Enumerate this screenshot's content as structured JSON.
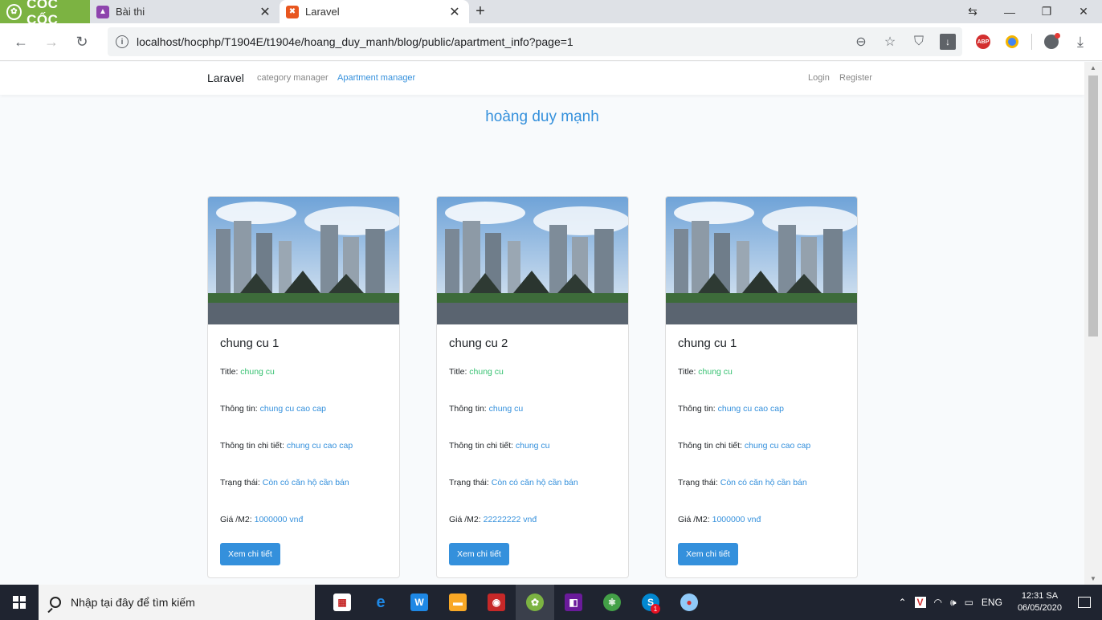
{
  "browser": {
    "brand": "CỐC CỐC",
    "tabs": [
      {
        "title": "Bài thi",
        "favicon_color": "#8e44ad"
      },
      {
        "title": "Laravel",
        "favicon_color": "#e8561f"
      }
    ],
    "url": "localhost/hocphp/T1904E/t1904e/hoang_duy_manh/blog/public/apartment_info?page=1",
    "abp_label": "ABP"
  },
  "navbar": {
    "brand": "Laravel",
    "links": [
      "category manager",
      "Apartment manager"
    ],
    "login": "Login",
    "register": "Register"
  },
  "heading": "hoàng duy mạnh",
  "labels": {
    "title": "Title: ",
    "info": "Thông tin: ",
    "detail": "Thông tin chi tiết: ",
    "status": "Trạng thái: ",
    "price": "Giá /M2: "
  },
  "cards": [
    {
      "name": "chung cu 1",
      "title": "chung cu",
      "info": "chung cu cao cap",
      "detail": "chung cu cao cap",
      "status": "Còn có căn hộ cần bán",
      "price": "1000000 vnđ",
      "button": "Xem chi tiết"
    },
    {
      "name": "chung cu 2",
      "title": "chung cu",
      "info": "chung cu",
      "detail": "chung cu",
      "status": "Còn có căn hộ cần bán",
      "price": "22222222 vnđ",
      "button": "Xem chi tiết"
    },
    {
      "name": "chung cu 1",
      "title": "chung cu",
      "info": "chung cu cao cap",
      "detail": "chung cu cao cap",
      "status": "Còn có căn hộ cần bán",
      "price": "1000000 vnđ",
      "button": "Xem chi tiết"
    }
  ],
  "taskbar": {
    "search_placeholder": "Nhập tại đây để tìm kiếm",
    "skype_badge": "1",
    "language": "ENG",
    "time": "12:31 SA",
    "date": "06/05/2020"
  },
  "colors": {
    "primary": "#3490dc",
    "green": "#38c172",
    "coccoc": "#7cb342"
  }
}
